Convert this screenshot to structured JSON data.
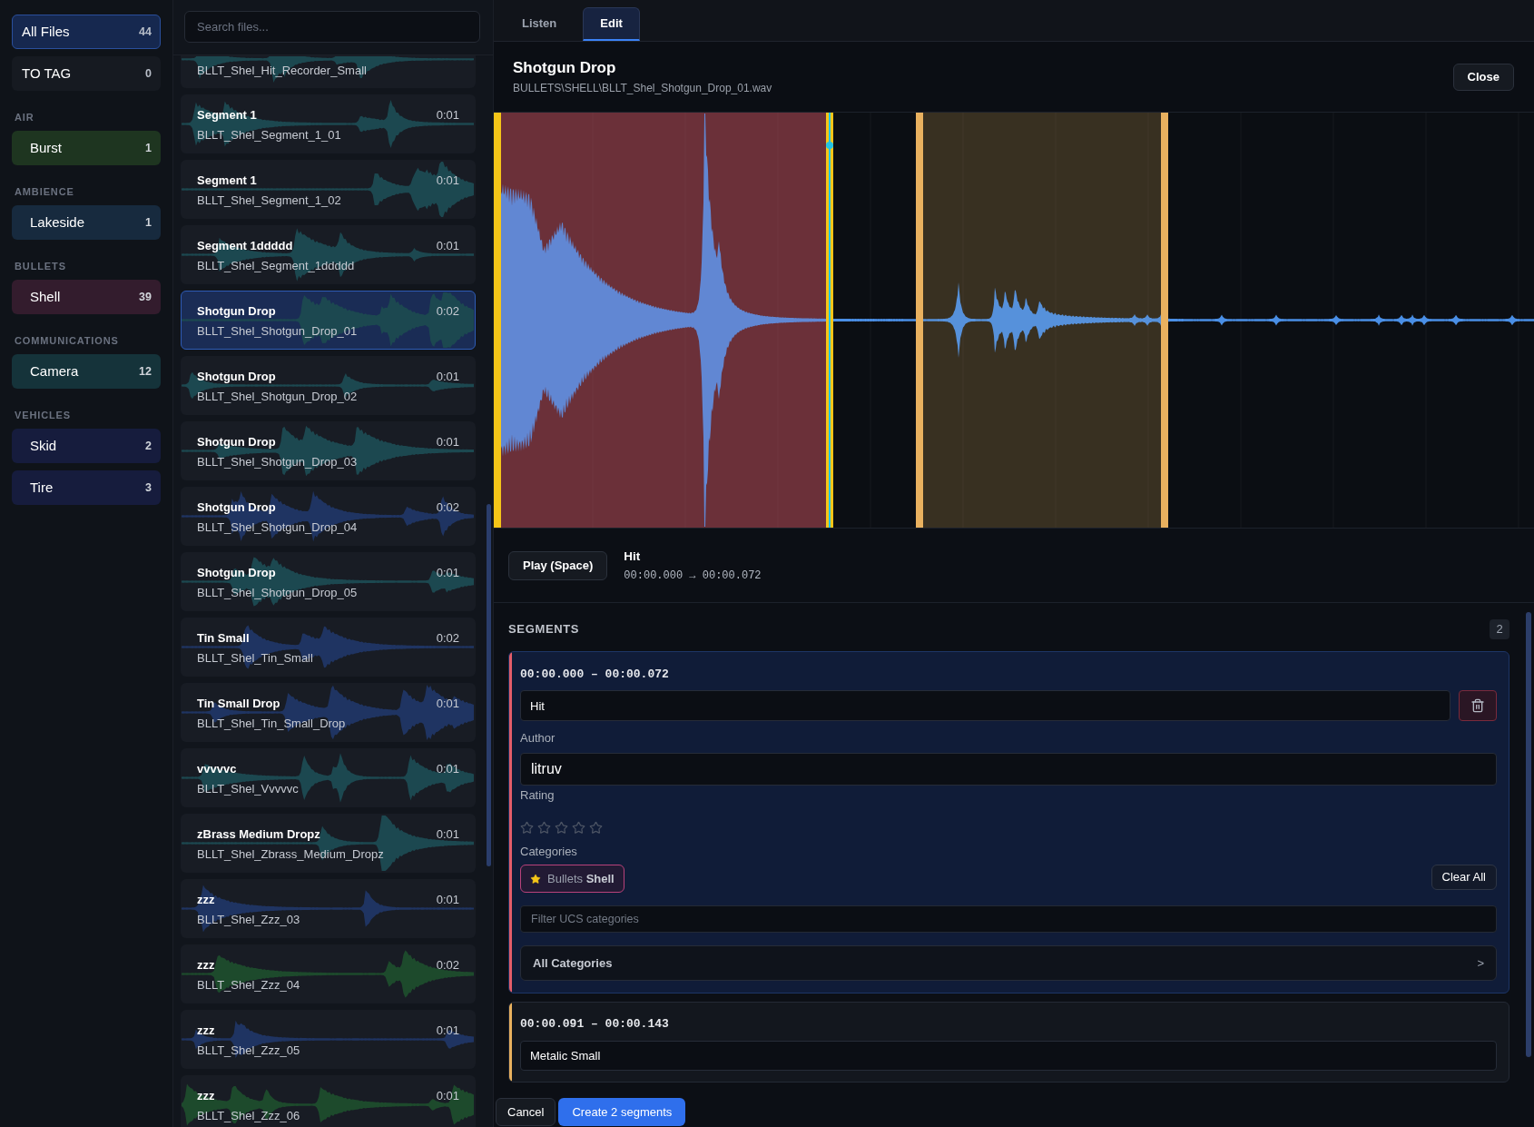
{
  "sidebar": {
    "items": [
      {
        "label": "All Files",
        "count": "44",
        "selected": true
      },
      {
        "label": "TO TAG",
        "count": "0",
        "selected": false
      }
    ],
    "groups": [
      {
        "heading": "AIR",
        "items": [
          {
            "label": "Burst",
            "count": "1",
            "selected": false,
            "color": "#1e3520"
          }
        ]
      },
      {
        "heading": "AMBIENCE",
        "items": [
          {
            "label": "Lakeside",
            "count": "1",
            "selected": false,
            "color": "#172a3e"
          }
        ]
      },
      {
        "heading": "BULLETS",
        "items": [
          {
            "label": "Shell",
            "count": "39",
            "selected": false,
            "color": "#331c2d"
          }
        ]
      },
      {
        "heading": "COMMUNICATIONS",
        "items": [
          {
            "label": "Camera",
            "count": "12",
            "selected": false,
            "color": "#15333a"
          }
        ]
      },
      {
        "heading": "VEHICLES",
        "items": [
          {
            "label": "Skid",
            "count": "2",
            "selected": false,
            "color": "#161c3d"
          },
          {
            "label": "Tire",
            "count": "3",
            "selected": false,
            "color": "#161c3d"
          }
        ]
      }
    ]
  },
  "file_list": {
    "search": {
      "placeholder": "Search files..."
    },
    "files": [
      {
        "filename": "BLLT_Shel_Hit_Recorder_Small",
        "selected": false,
        "color": "#1c4850"
      },
      {
        "title": "Segment 1",
        "duration": "0:01",
        "filename": "BLLT_Shel_Segment_1_01",
        "selected": false,
        "color": "#1c4850"
      },
      {
        "title": "Segment 1",
        "duration": "0:01",
        "filename": "BLLT_Shel_Segment_1_02",
        "selected": false,
        "color": "#1c4850"
      },
      {
        "title": "Segment 1ddddd",
        "duration": "0:01",
        "filename": "BLLT_Shel_Segment_1ddddd",
        "selected": false,
        "color": "#1c4850"
      },
      {
        "title": "Shotgun Drop",
        "duration": "0:02",
        "filename": "BLLT_Shel_Shotgun_Drop_01",
        "selected": true,
        "color": "#1c4850"
      },
      {
        "title": "Shotgun Drop",
        "duration": "0:01",
        "filename": "BLLT_Shel_Shotgun_Drop_02",
        "selected": false,
        "color": "#1c4850"
      },
      {
        "title": "Shotgun Drop",
        "duration": "0:01",
        "filename": "BLLT_Shel_Shotgun_Drop_03",
        "selected": false,
        "color": "#1c4850"
      },
      {
        "title": "Shotgun Drop",
        "duration": "0:02",
        "filename": "BLLT_Shel_Shotgun_Drop_04",
        "selected": false,
        "color": "#1f3462"
      },
      {
        "title": "Shotgun Drop",
        "duration": "0:01",
        "filename": "BLLT_Shel_Shotgun_Drop_05",
        "selected": false,
        "color": "#1c4850"
      },
      {
        "title": "Tin Small",
        "duration": "0:02",
        "filename": "BLLT_Shel_Tin_Small",
        "selected": false,
        "color": "#1f3462"
      },
      {
        "title": "Tin Small Drop",
        "duration": "0:01",
        "filename": "BLLT_Shel_Tin_Small_Drop",
        "selected": false,
        "color": "#1f3462"
      },
      {
        "title": "vvvvvc",
        "duration": "0:01",
        "filename": "BLLT_Shel_Vvvvvc",
        "selected": false,
        "color": "#1c4850"
      },
      {
        "title": "zBrass Medium Dropz",
        "duration": "0:01",
        "filename": "BLLT_Shel_Zbrass_Medium_Dropz",
        "selected": false,
        "color": "#1c4850"
      },
      {
        "title": "zzz",
        "duration": "0:01",
        "filename": "BLLT_Shel_Zzz_03",
        "selected": false,
        "color": "#1f3462"
      },
      {
        "title": "zzz",
        "duration": "0:02",
        "filename": "BLLT_Shel_Zzz_04",
        "selected": false,
        "color": "#1d4a2c"
      },
      {
        "title": "zzz",
        "duration": "0:01",
        "filename": "BLLT_Shel_Zzz_05",
        "selected": false,
        "color": "#1f3462"
      },
      {
        "title": "zzz",
        "duration": "0:01",
        "filename": "BLLT_Shel_Zzz_06",
        "selected": false,
        "color": "#1d4a2c"
      }
    ]
  },
  "editor": {
    "tabs": [
      {
        "label": "Listen",
        "selected": false
      },
      {
        "label": "Edit",
        "selected": true
      }
    ],
    "title": "Shotgun Drop",
    "path": "BULLETS\\SHELL\\BLLT_Shel_Shotgun_Drop_01.wav",
    "close_button": "Close",
    "play_button": "Play (Space)",
    "current_segment": {
      "name": "Hit",
      "range": "00:00.000 → 00:00.072"
    },
    "segments": {
      "heading": "SEGMENTS",
      "count": "2",
      "items": [
        {
          "range": "00:00.000 – 00:00.072",
          "name": "Hit",
          "selected": true,
          "color": "#e35d6a",
          "author_label": "Author",
          "author": "litruv",
          "rating_label": "Rating",
          "stars": 0,
          "categories_label": "Categories",
          "categories": [
            {
              "label": "Bullets **Shell**"
            }
          ],
          "clear_button": "Clear All",
          "filter_placeholder": "Filter UCS categories",
          "browse": {
            "label": "All Categories",
            "chevron": ">"
          }
        },
        {
          "range": "00:00.091 – 00:00.143",
          "name": "Metalic Small",
          "selected": false,
          "color": "#e9b15f"
        }
      ]
    },
    "cancel_button": "Cancel",
    "create_button": "Create 2 segments"
  }
}
